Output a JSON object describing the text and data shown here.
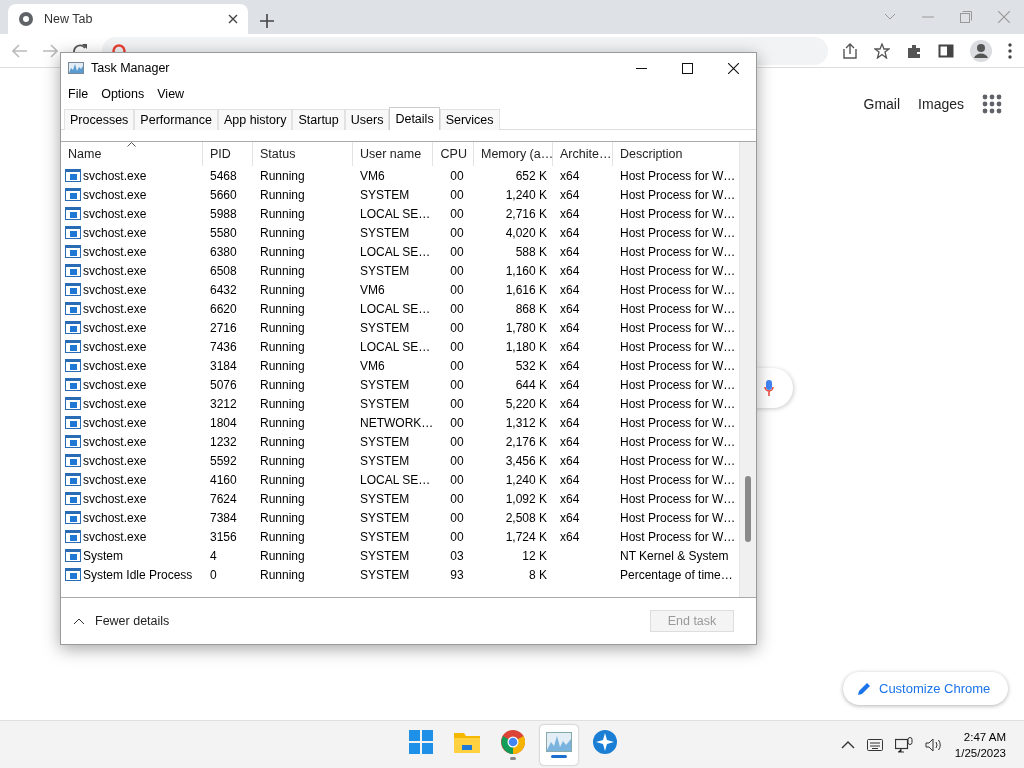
{
  "browser": {
    "tab": {
      "title": "New Tab"
    },
    "links": [
      "Gmail",
      "Images"
    ],
    "customize_button": "Customize Chrome"
  },
  "task_manager": {
    "title": "Task Manager",
    "menu": [
      "File",
      "Options",
      "View"
    ],
    "tabs": [
      {
        "label": "Processes",
        "selected": false
      },
      {
        "label": "Performance",
        "selected": false
      },
      {
        "label": "App history",
        "selected": false
      },
      {
        "label": "Startup",
        "selected": false
      },
      {
        "label": "Users",
        "selected": false
      },
      {
        "label": "Details",
        "selected": true
      },
      {
        "label": "Services",
        "selected": false
      }
    ],
    "table": {
      "columns": [
        {
          "label": "Name",
          "sorted": true
        },
        {
          "label": "PID",
          "sorted": false
        },
        {
          "label": "Status",
          "sorted": false
        },
        {
          "label": "User name",
          "sorted": false
        },
        {
          "label": "CPU",
          "sorted": false
        },
        {
          "label": "Memory (a…",
          "sorted": false
        },
        {
          "label": "Archite…",
          "sorted": false
        },
        {
          "label": "Description",
          "sorted": false
        }
      ],
      "rows": [
        {
          "name": "svchost.exe",
          "pid": "5468",
          "status": "Running",
          "user": "VM6",
          "cpu": "00",
          "memory": "652 K",
          "arch": "x64",
          "description": "Host Process for W…"
        },
        {
          "name": "svchost.exe",
          "pid": "5660",
          "status": "Running",
          "user": "SYSTEM",
          "cpu": "00",
          "memory": "1,240 K",
          "arch": "x64",
          "description": "Host Process for W…"
        },
        {
          "name": "svchost.exe",
          "pid": "5988",
          "status": "Running",
          "user": "LOCAL SE…",
          "cpu": "00",
          "memory": "2,716 K",
          "arch": "x64",
          "description": "Host Process for W…"
        },
        {
          "name": "svchost.exe",
          "pid": "5580",
          "status": "Running",
          "user": "SYSTEM",
          "cpu": "00",
          "memory": "4,020 K",
          "arch": "x64",
          "description": "Host Process for W…"
        },
        {
          "name": "svchost.exe",
          "pid": "6380",
          "status": "Running",
          "user": "LOCAL SE…",
          "cpu": "00",
          "memory": "588 K",
          "arch": "x64",
          "description": "Host Process for W…"
        },
        {
          "name": "svchost.exe",
          "pid": "6508",
          "status": "Running",
          "user": "SYSTEM",
          "cpu": "00",
          "memory": "1,160 K",
          "arch": "x64",
          "description": "Host Process for W…"
        },
        {
          "name": "svchost.exe",
          "pid": "6432",
          "status": "Running",
          "user": "VM6",
          "cpu": "00",
          "memory": "1,616 K",
          "arch": "x64",
          "description": "Host Process for W…"
        },
        {
          "name": "svchost.exe",
          "pid": "6620",
          "status": "Running",
          "user": "LOCAL SE…",
          "cpu": "00",
          "memory": "868 K",
          "arch": "x64",
          "description": "Host Process for W…"
        },
        {
          "name": "svchost.exe",
          "pid": "2716",
          "status": "Running",
          "user": "SYSTEM",
          "cpu": "00",
          "memory": "1,780 K",
          "arch": "x64",
          "description": "Host Process for W…"
        },
        {
          "name": "svchost.exe",
          "pid": "7436",
          "status": "Running",
          "user": "LOCAL SE…",
          "cpu": "00",
          "memory": "1,180 K",
          "arch": "x64",
          "description": "Host Process for W…"
        },
        {
          "name": "svchost.exe",
          "pid": "3184",
          "status": "Running",
          "user": "VM6",
          "cpu": "00",
          "memory": "532 K",
          "arch": "x64",
          "description": "Host Process for W…"
        },
        {
          "name": "svchost.exe",
          "pid": "5076",
          "status": "Running",
          "user": "SYSTEM",
          "cpu": "00",
          "memory": "644 K",
          "arch": "x64",
          "description": "Host Process for W…"
        },
        {
          "name": "svchost.exe",
          "pid": "3212",
          "status": "Running",
          "user": "SYSTEM",
          "cpu": "00",
          "memory": "5,220 K",
          "arch": "x64",
          "description": "Host Process for W…"
        },
        {
          "name": "svchost.exe",
          "pid": "1804",
          "status": "Running",
          "user": "NETWORK…",
          "cpu": "00",
          "memory": "1,312 K",
          "arch": "x64",
          "description": "Host Process for W…"
        },
        {
          "name": "svchost.exe",
          "pid": "1232",
          "status": "Running",
          "user": "SYSTEM",
          "cpu": "00",
          "memory": "2,176 K",
          "arch": "x64",
          "description": "Host Process for W…"
        },
        {
          "name": "svchost.exe",
          "pid": "5592",
          "status": "Running",
          "user": "SYSTEM",
          "cpu": "00",
          "memory": "3,456 K",
          "arch": "x64",
          "description": "Host Process for W…"
        },
        {
          "name": "svchost.exe",
          "pid": "4160",
          "status": "Running",
          "user": "LOCAL SE…",
          "cpu": "00",
          "memory": "1,240 K",
          "arch": "x64",
          "description": "Host Process for W…"
        },
        {
          "name": "svchost.exe",
          "pid": "7624",
          "status": "Running",
          "user": "SYSTEM",
          "cpu": "00",
          "memory": "1,092 K",
          "arch": "x64",
          "description": "Host Process for W…"
        },
        {
          "name": "svchost.exe",
          "pid": "7384",
          "status": "Running",
          "user": "SYSTEM",
          "cpu": "00",
          "memory": "2,508 K",
          "arch": "x64",
          "description": "Host Process for W…"
        },
        {
          "name": "svchost.exe",
          "pid": "3156",
          "status": "Running",
          "user": "SYSTEM",
          "cpu": "00",
          "memory": "1,724 K",
          "arch": "x64",
          "description": "Host Process for W…"
        },
        {
          "name": "System",
          "pid": "4",
          "status": "Running",
          "user": "SYSTEM",
          "cpu": "03",
          "memory": "12 K",
          "description": "NT Kernel & System"
        },
        {
          "name": "System Idle Process",
          "pid": "0",
          "status": "Running",
          "user": "SYSTEM",
          "cpu": "93",
          "memory": "8 K",
          "description": "Percentage of time…"
        }
      ]
    },
    "footer": {
      "toggle": "Fewer details",
      "end_task": {
        "label": "End task",
        "disabled": true
      }
    }
  },
  "taskbar": {
    "apps": [
      {
        "kind": "start",
        "running": false,
        "selected": false
      },
      {
        "kind": "folder",
        "running": false,
        "selected": false
      },
      {
        "kind": "browser",
        "running": true,
        "selected": false
      },
      {
        "kind": "monitor",
        "running": true,
        "selected": true
      },
      {
        "kind": "compass",
        "running": false,
        "selected": false
      }
    ],
    "time": "2:47 AM",
    "date": "1/25/2023"
  }
}
